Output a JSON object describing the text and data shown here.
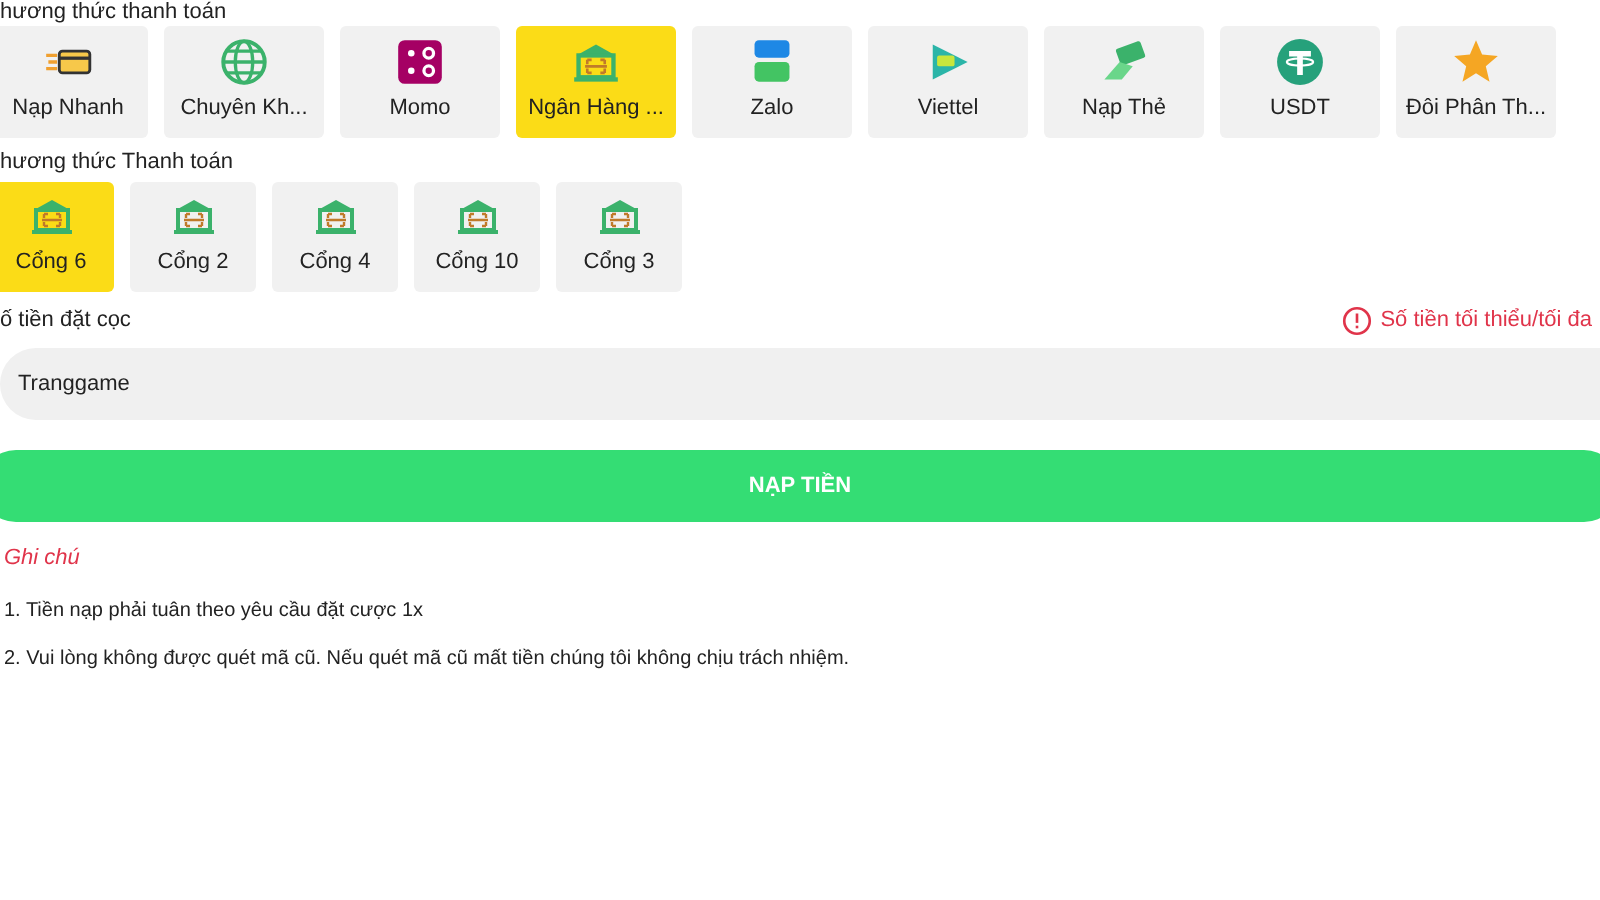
{
  "methods_label": "hương thức thanh toán",
  "methods": [
    {
      "kind": "fast",
      "label": "Nạp Nhanh",
      "selected": false
    },
    {
      "kind": "globe",
      "label": "Chuyên Kh...",
      "selected": false
    },
    {
      "kind": "momo",
      "label": "Momo",
      "selected": false
    },
    {
      "kind": "bank",
      "label": "Ngân Hàng ...",
      "selected": true
    },
    {
      "kind": "zalo",
      "label": "Zalo",
      "selected": false
    },
    {
      "kind": "viettel",
      "label": "Viettel",
      "selected": false
    },
    {
      "kind": "card",
      "label": "Nạp Thẻ",
      "selected": false
    },
    {
      "kind": "usdt",
      "label": "USDT",
      "selected": false
    },
    {
      "kind": "star",
      "label": "Đôi Phân Th...",
      "selected": false
    }
  ],
  "gates_label": "hương thức Thanh toán",
  "gates": [
    {
      "label": "Cổng 6",
      "selected": true
    },
    {
      "label": "Cổng 2",
      "selected": false
    },
    {
      "label": "Cổng 4",
      "selected": false
    },
    {
      "label": "Cổng 10",
      "selected": false
    },
    {
      "label": "Cổng 3",
      "selected": false
    }
  ],
  "amount_label": "ố tiền đặt cọc",
  "amount_hint": "Số tiền tối thiểu/tối đa",
  "amount_field": {
    "value": "Tranggame"
  },
  "submit_button": "NẠP TIỀN",
  "notes_title": "Ghi chú",
  "notes": [
    "1. Tiền nạp phải tuân theo yêu cầu đặt cược 1x",
    "2. Vui lòng không được quét mã cũ. Nếu quét mã cũ mất tiền chúng tôi không chịu trách nhiệm."
  ]
}
